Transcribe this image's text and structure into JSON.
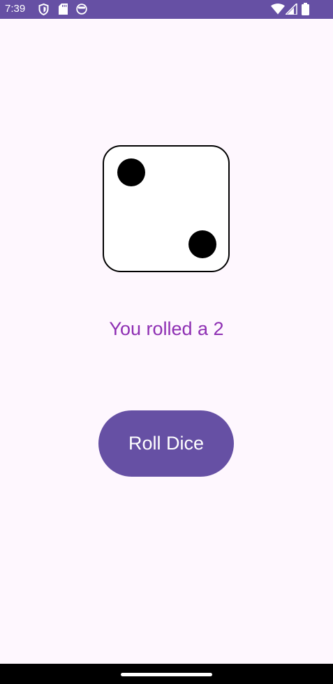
{
  "status_bar": {
    "time": "7:39",
    "left_icons": [
      "shield-icon",
      "sd-card-icon",
      "face-icon"
    ],
    "right_icons": [
      "wifi-icon",
      "signal-icon",
      "battery-icon"
    ],
    "color": "#6650a4"
  },
  "dice": {
    "value": 2,
    "pips": [
      "top-left",
      "bottom-right"
    ]
  },
  "result": {
    "text": "You rolled a 2",
    "color": "#8e2fb3"
  },
  "roll_button": {
    "label": "Roll Dice",
    "color": "#6650a4"
  },
  "nav_bar": {
    "handle": "home-handle"
  }
}
